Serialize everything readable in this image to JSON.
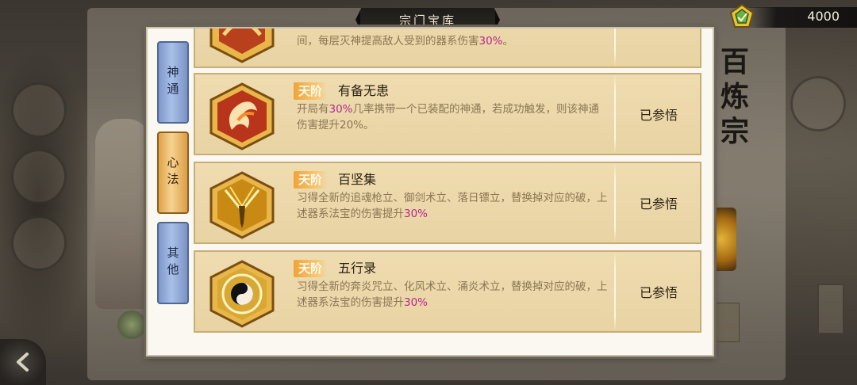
{
  "header": {
    "title": "宗门宝库",
    "currency": {
      "value": "4000",
      "icon": "jade-token-icon"
    }
  },
  "sect": {
    "name": "百炼宗"
  },
  "tabs": [
    {
      "label": "神通",
      "state": "inactive"
    },
    {
      "label": "心法",
      "state": "active"
    },
    {
      "label": "其他",
      "state": "inactive"
    }
  ],
  "cards": [
    {
      "icon": "flame-fan-icon",
      "desc_parts": [
        "间，每层灭神提高敌人受到的器系伤害",
        "30%",
        "。"
      ],
      "status": ""
    },
    {
      "rank": "天阶",
      "name": "有备无患",
      "icon": "fire-swirl-icon",
      "desc_parts": [
        "开局有",
        "30%",
        "几率携带一个已装配的神通，若成功触发，则该神通伤害提升20%。"
      ],
      "status": "已参悟"
    },
    {
      "rank": "天阶",
      "name": "百坚集",
      "icon": "golden-sword-icon",
      "desc_parts": [
        "习得全新的追魂枪立、御剑术立、落日镖立，替换掉对应的破，上述器系法宝的伤害提升",
        "30%",
        ""
      ],
      "status": "已参悟"
    },
    {
      "rank": "天阶",
      "name": "五行录",
      "icon": "yin-yang-icon",
      "desc_parts": [
        "习得全新的奔炎咒立、化风术立、涌炎术立，替换掉对应的破，上述器系法宝的伤害提升",
        "30%",
        ""
      ],
      "status": "已参悟"
    }
  ],
  "colors": {
    "highlight": "#b5288e",
    "rank_badge": "#f0a43a",
    "tab_active": "#f5d391",
    "tab_inactive": "#a9c0e8"
  }
}
